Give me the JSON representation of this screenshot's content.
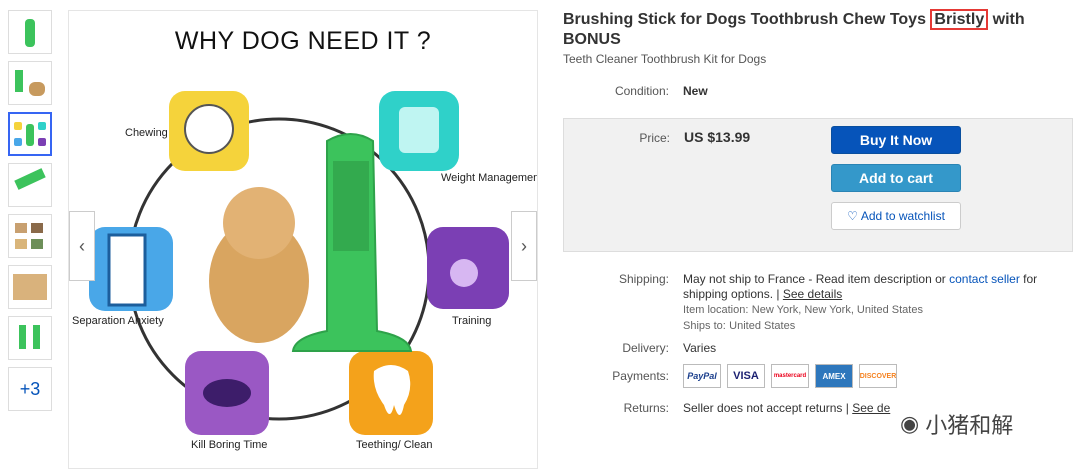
{
  "thumbnails": {
    "more_label": "+3"
  },
  "image": {
    "headline": "WHY DOG NEED IT ?",
    "features": [
      "Chewing",
      "Weight Management",
      "Separation Anxiety",
      "Training",
      "Kill Boring Time",
      "Teething/ Clean"
    ],
    "prev": "‹",
    "next": "›"
  },
  "listing": {
    "title_pre": "Brushing Stick for Dogs Toothbrush Chew Toys ",
    "title_hl": "Bristly",
    "title_post": " with BONUS",
    "subtitle": "Teeth Cleaner Toothbrush Kit for Dogs"
  },
  "condition": {
    "label": "Condition:",
    "value": "New"
  },
  "price": {
    "label": "Price:",
    "value": "US $13.99"
  },
  "buttons": {
    "buy": "Buy It Now",
    "cart": "Add to cart",
    "watch": "Add to watchlist"
  },
  "shipping": {
    "label": "Shipping:",
    "line1": "May not ship to France - Read item description or",
    "contact": "contact seller",
    "for": "for",
    "line2": "shipping options. |",
    "details": "See details",
    "location_label": "Item location:",
    "location": "New York, New York, United States",
    "ships_label": "Ships to:",
    "ships": "United States"
  },
  "delivery": {
    "label": "Delivery:",
    "value": "Varies"
  },
  "payments": {
    "label": "Payments:",
    "methods": [
      "PayPal",
      "VISA",
      "mastercard",
      "AMEX",
      "DISCOVER"
    ]
  },
  "returns": {
    "label": "Returns:",
    "value": "Seller does not accept returns |",
    "details": "See de"
  },
  "watermark": "小猪和解",
  "colors": {
    "buy": "#0654ba",
    "cart": "#3498ca",
    "highlight": "#e53935",
    "toy_green": "#3cc35c"
  }
}
